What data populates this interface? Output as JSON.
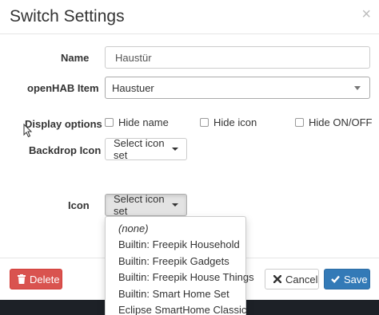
{
  "dialog": {
    "title": "Switch Settings",
    "close_label": "×"
  },
  "form": {
    "name_label": "Name",
    "name_value": "Haustür",
    "item_label": "openHAB Item",
    "item_value": "Haustuer",
    "display_options_label": "Display options",
    "options": [
      {
        "label": "Hide name",
        "checked": false
      },
      {
        "label": "Hide icon",
        "checked": false
      },
      {
        "label": "Hide ON/OFF",
        "checked": false
      }
    ],
    "backdrop_label": "Backdrop Icon",
    "backdrop_button": "Select icon set",
    "icon_label": "Icon",
    "icon_button": "Select icon set"
  },
  "icon_dropdown": {
    "items": [
      "(none)",
      "Builtin: Freepik Household",
      "Builtin: Freepik Gadgets",
      "Builtin: Freepik House Things",
      "Builtin: Smart Home Set",
      "Eclipse SmartHome Classic"
    ]
  },
  "footer": {
    "delete_label": "Delete",
    "cancel_label": "Cancel",
    "save_label": "Save"
  },
  "colors": {
    "danger": "#d9534f",
    "primary": "#337ab7",
    "backdrop": "#1d2127"
  },
  "icons": {
    "delete": "trash-icon",
    "cancel": "times-icon",
    "save": "check-icon",
    "close": "close-icon",
    "cursor": "mouse-pointer-icon"
  }
}
